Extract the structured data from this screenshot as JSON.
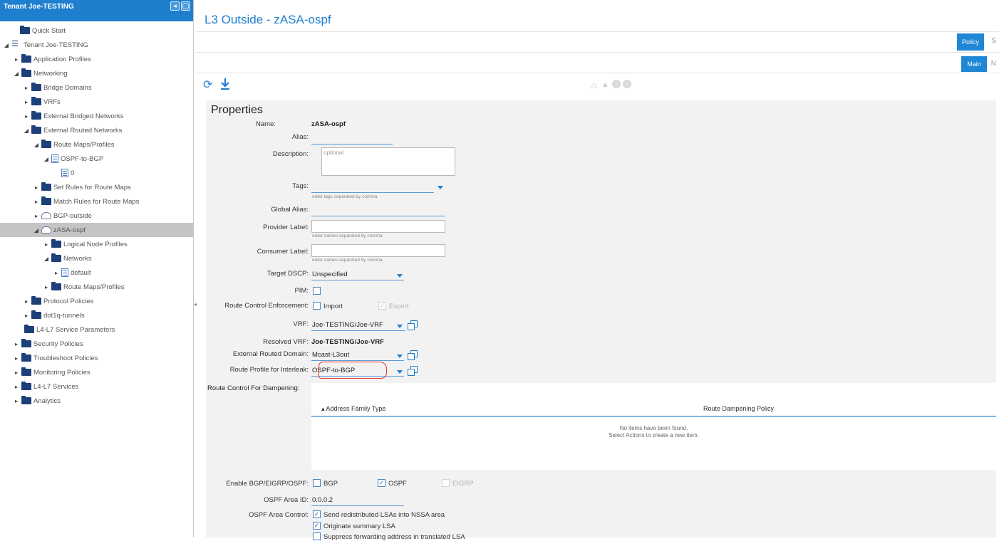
{
  "sidebar": {
    "title": "Tenant Joe-TESTING",
    "items": [
      {
        "label": "Quick Start"
      },
      {
        "label": "Tenant Joe-TESTING"
      },
      {
        "label": "Application Profiles"
      },
      {
        "label": "Networking"
      },
      {
        "label": "Bridge Domains"
      },
      {
        "label": "VRFs"
      },
      {
        "label": "External Bridged Networks"
      },
      {
        "label": "External Routed Networks"
      },
      {
        "label": "Route Maps/Profiles"
      },
      {
        "label": "OSPF-to-BGP"
      },
      {
        "label": "0"
      },
      {
        "label": "Set Rules for Route Maps"
      },
      {
        "label": "Match Rules for Route Maps"
      },
      {
        "label": "BGP-outside"
      },
      {
        "label": "zASA-ospf"
      },
      {
        "label": "Logical Node Profiles"
      },
      {
        "label": "Networks"
      },
      {
        "label": "default"
      },
      {
        "label": "Route Maps/Profiles"
      },
      {
        "label": "Protocol Policies"
      },
      {
        "label": "dot1q-tunnels"
      },
      {
        "label": "L4-L7 Service Parameters"
      },
      {
        "label": "Security Policies"
      },
      {
        "label": "Troubleshoot Policies"
      },
      {
        "label": "Monitoring Policies"
      },
      {
        "label": "L4-L7 Services"
      },
      {
        "label": "Analytics"
      }
    ]
  },
  "main": {
    "title": "L3 Outside - zASA-ospf",
    "tab_policy": "Policy",
    "tab_s": "S",
    "tab_main": "Main",
    "tab_n": "N"
  },
  "properties": {
    "heading": "Properties",
    "name_label": "Name:",
    "name_value": "zASA-ospf",
    "alias_label": "Alias:",
    "description_label": "Description:",
    "description_placeholder": "optional",
    "tags_label": "Tags:",
    "tags_hint": "enter tags separated by comma",
    "global_alias_label": "Global Alias:",
    "provider_label": "Provider Label:",
    "provider_hint": "enter names separated by comma",
    "consumer_label": "Consumer Label:",
    "consumer_hint": "enter names separated by comma",
    "target_dscp_label": "Target DSCP:",
    "target_dscp_value": "Unspecified",
    "pim_label": "PIM:",
    "route_control_label": "Route Control Enforcement:",
    "import_label": "Import",
    "export_label": "Export",
    "vrf_label": "VRF:",
    "vrf_value": "Joe-TESTING/Joe-VRF",
    "resolved_vrf_label": "Resolved VRF:",
    "resolved_vrf_value": "Joe-TESTING/Joe-VRF",
    "ext_domain_label": "External Routed Domain:",
    "ext_domain_value": "Mcast-L3out",
    "interleak_label": "Route Profile for Interleak:",
    "interleak_value": "OSPF-to-BGP",
    "dampening_label": "Route Control For Dampening:",
    "damp_col1": "Address Family Type",
    "damp_col2": "Route Dampening Policy",
    "damp_empty1": "No items have been found.",
    "damp_empty2": "Select Actions to create a new item.",
    "enable_label": "Enable BGP/EIGRP/OSPF:",
    "bgp_label": "BGP",
    "ospf_label": "OSPF",
    "eigrp_label": "EIGRP",
    "area_id_label": "OSPF Area ID:",
    "area_id_value": "0.0.0.2",
    "area_control_label": "OSPF Area Control:",
    "area_opt1": "Send redistributed LSAs into NSSA area",
    "area_opt2": "Originate summary LSA",
    "area_opt3": "Suppress forwarding address in translated LSA"
  }
}
